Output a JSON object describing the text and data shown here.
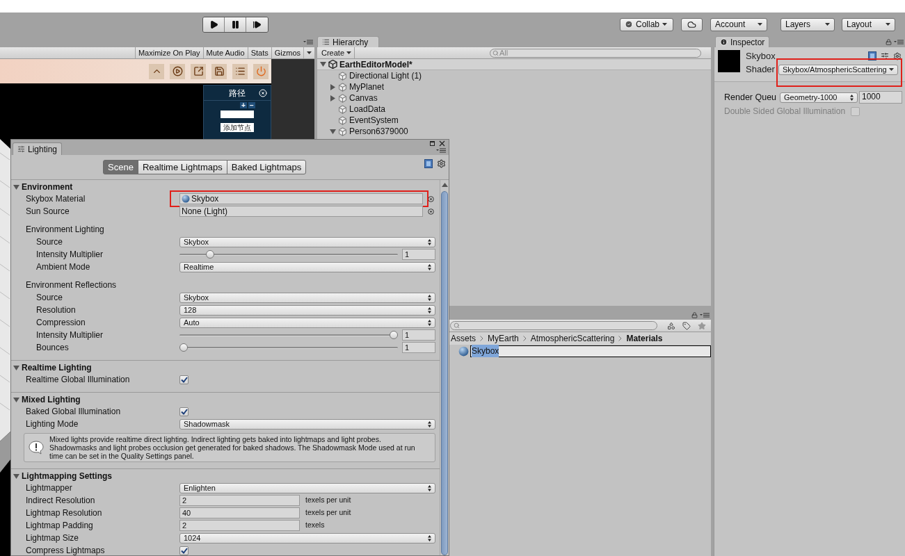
{
  "toolbar": {
    "collab": "Collab",
    "account": "Account",
    "layers": "Layers",
    "layout": "Layout"
  },
  "game_view": {
    "toolbar": [
      {
        "label": "Maximize On Play",
        "kind": "toggle"
      },
      {
        "label": "Mute Audio",
        "kind": "toggle"
      },
      {
        "label": "Stats",
        "kind": "toggle"
      },
      {
        "label": "Gizmos",
        "kind": "dropdown"
      }
    ],
    "route_panel": {
      "title": "路径",
      "add": "+",
      "remove": "−",
      "button": "添加节点"
    }
  },
  "hierarchy": {
    "tab": "Hierarchy",
    "create": "Create",
    "search_placeholder": "All",
    "items": [
      {
        "name": "EarthEditorModel*",
        "kind": "scene",
        "expanded": true,
        "children": [
          {
            "name": "Directional Light (1)",
            "kind": "object"
          },
          {
            "name": "MyPlanet",
            "kind": "object",
            "expanded": false
          },
          {
            "name": "Canvas",
            "kind": "object",
            "expanded": false
          },
          {
            "name": "LoadData",
            "kind": "object"
          },
          {
            "name": "EventSystem",
            "kind": "object"
          },
          {
            "name": "Person6379000",
            "kind": "object",
            "expanded": true
          }
        ]
      }
    ]
  },
  "project": {
    "breadcrumb": [
      {
        "label": "Assets",
        "current": false
      },
      {
        "label": "MyEarth",
        "current": false
      },
      {
        "label": "AtmosphericScattering",
        "current": false
      },
      {
        "label": "Materials",
        "current": true
      }
    ],
    "items": [
      {
        "name": "Skybox",
        "selected": true
      }
    ]
  },
  "inspector": {
    "tab": "Inspector",
    "title": "Skybox",
    "shader_label": "Shader",
    "shader": "Skybox/AtmosphericScattering",
    "shader_highlighted": true,
    "fields": [
      {
        "kind": "queue",
        "label": "Render Queu",
        "value": "Geometry-1000",
        "number": "1000"
      },
      {
        "kind": "checkbox",
        "label": "Double Sided Global Illumination",
        "checked": false,
        "disabled": true
      }
    ]
  },
  "lighting": {
    "tab": "Lighting",
    "tabs": [
      {
        "label": "Scene",
        "selected": true
      },
      {
        "label": "Realtime Lightmaps",
        "selected": false
      },
      {
        "label": "Baked Lightmaps",
        "selected": false
      }
    ],
    "sections": [
      {
        "title": "Environment",
        "expanded": true,
        "rows": [
          {
            "kind": "material",
            "label": "Skybox Material",
            "value": "Skybox",
            "highlighted": true
          },
          {
            "kind": "object",
            "label": "Sun Source",
            "value": "None (Light)",
            "highlighted": false
          },
          {
            "kind": "group",
            "label": "Environment Lighting",
            "children": [
              {
                "kind": "dropdown",
                "label": "Source",
                "value": "Skybox"
              },
              {
                "kind": "slider",
                "label": "Intensity Multiplier",
                "level": 0.125,
                "value": "1"
              },
              {
                "kind": "dropdown",
                "label": "Ambient Mode",
                "value": "Realtime"
              }
            ]
          },
          {
            "kind": "group",
            "label": "Environment Reflections",
            "children": [
              {
                "kind": "dropdown",
                "label": "Source",
                "value": "Skybox"
              },
              {
                "kind": "dropdown",
                "label": "Resolution",
                "value": "128"
              },
              {
                "kind": "dropdown",
                "label": "Compression",
                "value": "Auto"
              },
              {
                "kind": "slider",
                "label": "Intensity Multiplier",
                "level": 1,
                "value": "1"
              },
              {
                "kind": "slider",
                "label": "Bounces",
                "level": 0,
                "value": "1"
              }
            ]
          }
        ]
      },
      {
        "title": "Realtime Lighting",
        "expanded": true,
        "rows": [
          {
            "kind": "checkbox",
            "label": "Realtime Global Illumination",
            "checked": true
          }
        ]
      },
      {
        "title": "Mixed Lighting",
        "expanded": true,
        "rows": [
          {
            "kind": "checkbox",
            "label": "Baked Global Illumination",
            "checked": true
          },
          {
            "kind": "dropdown",
            "label": "Lighting Mode",
            "value": "Shadowmask"
          },
          {
            "kind": "info",
            "text": "Mixed lights provide realtime direct lighting. Indirect lighting gets baked into lightmaps and light probes. Shadowmasks and light probes occlusion get generated for baked shadows. The Shadowmask Mode used at run time can be set in the Quality Settings panel."
          }
        ]
      },
      {
        "title": "Lightmapping Settings",
        "expanded": true,
        "rows": [
          {
            "kind": "dropdown",
            "label": "Lightmapper",
            "value": "Enlighten"
          },
          {
            "kind": "number",
            "label": "Indirect Resolution",
            "value": "2",
            "unit": "texels per unit"
          },
          {
            "kind": "number",
            "label": "Lightmap Resolution",
            "value": "40",
            "unit": "texels per unit"
          },
          {
            "kind": "number",
            "label": "Lightmap Padding",
            "value": "2",
            "unit": "texels"
          },
          {
            "kind": "dropdown",
            "label": "Lightmap Size",
            "value": "1024"
          },
          {
            "kind": "checkbox",
            "label": "Compress Lightmaps",
            "checked": true
          }
        ]
      }
    ]
  }
}
